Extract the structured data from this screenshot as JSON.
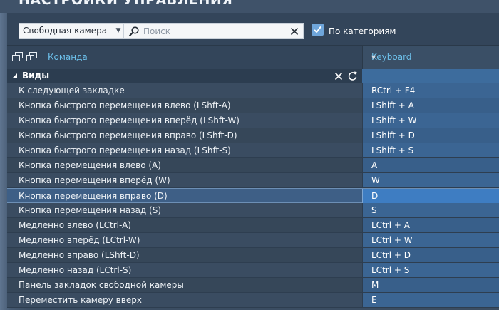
{
  "window": {
    "title": "НАСТРОЙКИ УПРАВЛЕНИЯ"
  },
  "toolbar": {
    "context_dropdown": "Свободная камера",
    "search_placeholder": "Поиск",
    "search_value": "",
    "by_category_label": "По категориям",
    "by_category_checked": true
  },
  "table": {
    "header_command": "Команда",
    "header_keyboard": "Keyboard",
    "group": {
      "title": "Виды",
      "expanded": true
    },
    "rows": [
      {
        "command": "К следующей закладке",
        "key": "RCtrl + F4"
      },
      {
        "command": "Кнопка быстрого перемещения влево (LShft-A)",
        "key": "LShift + A"
      },
      {
        "command": "Кнопка быстрого перемещения вперёд (LShft-W)",
        "key": "LShift + W"
      },
      {
        "command": "Кнопка быстрого перемещения вправо (LShft-D)",
        "key": "LShift + D"
      },
      {
        "command": "Кнопка быстрого перемещения назад (LShft-S)",
        "key": "LShift + S"
      },
      {
        "command": "Кнопка перемещения влево (A)",
        "key": "A"
      },
      {
        "command": "Кнопка перемещения вперёд (W)",
        "key": "W"
      },
      {
        "command": "Кнопка перемещения вправо (D)",
        "key": "D",
        "selected": true
      },
      {
        "command": "Кнопка перемещения назад (S)",
        "key": "S"
      },
      {
        "command": "Медленно влево (LCtrl-A)",
        "key": "LCtrl + A"
      },
      {
        "command": "Медленно вперёд (LCtrl-W)",
        "key": "LCtrl + W"
      },
      {
        "command": "Медленно вправо (LShft-D)",
        "key": "LCtrl + D"
      },
      {
        "command": "Медленно назад (LCtrl-S)",
        "key": "LCtrl + S"
      },
      {
        "command": "Панель закладок свободной камеры",
        "key": "M"
      },
      {
        "command": "Переместить камеру вверх",
        "key": "E"
      }
    ]
  },
  "icons": {
    "search": "magnifier-icon",
    "clear": "close-icon",
    "checkbox": "checkmark-icon",
    "collapse_all": "collapse-all-icon",
    "expand_all": "expand-all-icon",
    "group_toggle": "triangle-down-icon",
    "group_clear": "close-icon",
    "group_reset": "reset-icon",
    "sort": "chevron-down-icon"
  },
  "colors": {
    "background": "#3b4d62",
    "header_accent": "#6cbfe9",
    "key_column": "#3b6593",
    "selected_key": "#3e7dc2",
    "checkbox": "#6fa6db"
  }
}
